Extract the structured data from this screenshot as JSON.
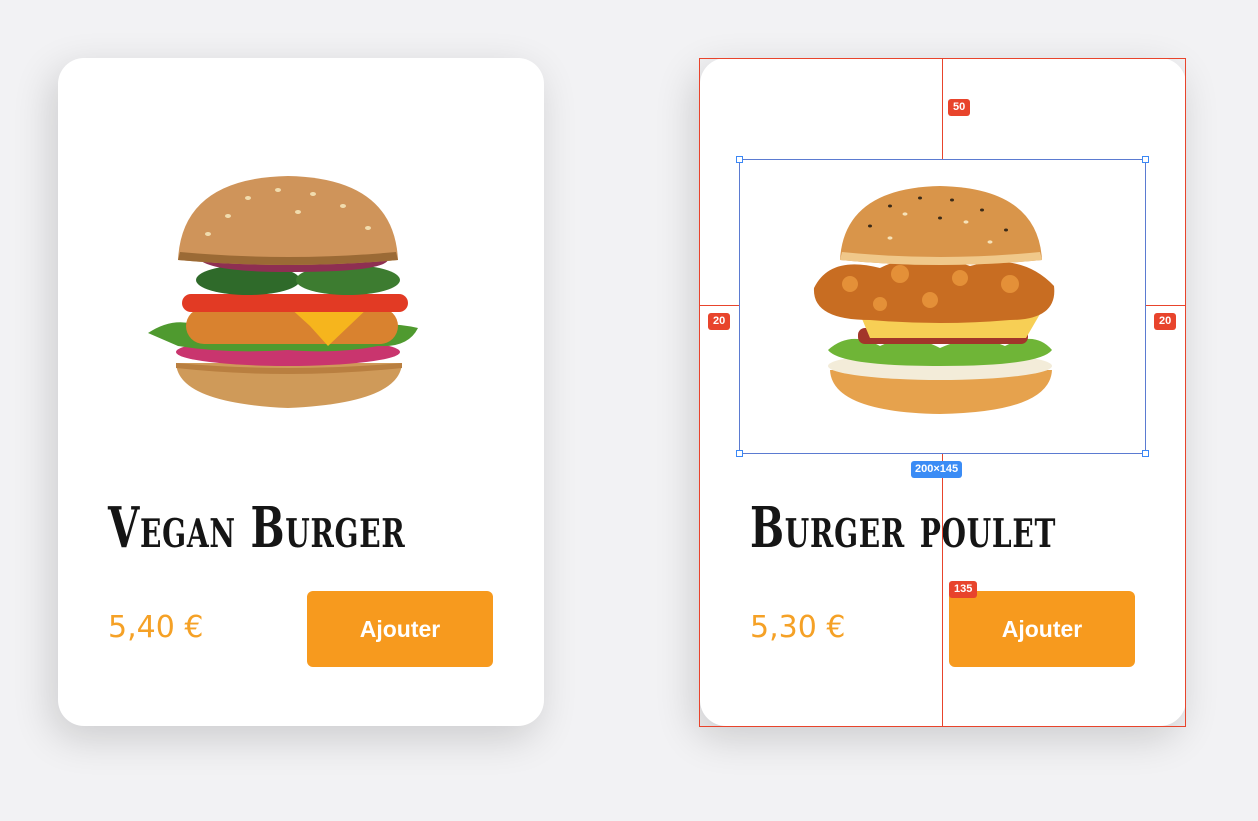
{
  "products": [
    {
      "name": "Vegan Burger",
      "price": "5,40 €",
      "button_label": "Ajouter",
      "image_icon": "vegan-burger-image"
    },
    {
      "name": "Burger poulet",
      "price": "5,30 €",
      "button_label": "Ajouter",
      "image_icon": "chicken-burger-image"
    }
  ],
  "inspector": {
    "padding_top": "50",
    "padding_left": "20",
    "padding_right": "20",
    "image_size": "200×145",
    "gap_label": "135"
  },
  "colors": {
    "accent": "#f79a1e",
    "price": "#f5a126",
    "inspector_red": "#e8442c",
    "inspector_blue": "#3b8cf5"
  }
}
